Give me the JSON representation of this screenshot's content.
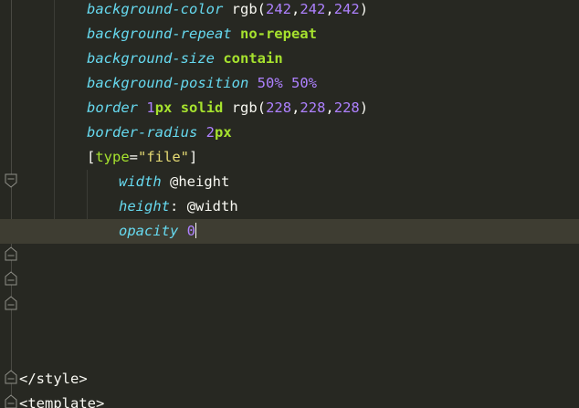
{
  "editor": {
    "lines": [
      {
        "prop": "background-color",
        "fn": "rgb",
        "args": [
          "242",
          "242",
          "242"
        ]
      },
      {
        "prop": "background-repeat",
        "value": "no-repeat"
      },
      {
        "prop": "background-size",
        "value": "contain"
      },
      {
        "prop": "background-position",
        "v1": "50%",
        "v2": "50%"
      },
      {
        "prop": "border",
        "num": "1",
        "unit": "px",
        "kw": "solid",
        "fn": "rgb",
        "args": [
          "228",
          "228",
          "228"
        ]
      },
      {
        "prop": "border-radius",
        "num": "2",
        "unit": "px"
      },
      {
        "selector_open": "[",
        "attr": "type",
        "eq": "=",
        "str": "\"file\"",
        "selector_close": "]"
      },
      {
        "prop": "width",
        "value": "@height"
      },
      {
        "prop": "height",
        "colon": ":",
        "value": "@width"
      },
      {
        "prop": "opacity",
        "value": "0"
      }
    ],
    "style_close": "</style>",
    "template_open": "<template>"
  },
  "colors": {
    "background": "#272822",
    "current_line": "#3e3d32",
    "property": "#66d9ef",
    "number": "#ae81ff",
    "keyword": "#a6e22e",
    "string": "#e6db74"
  }
}
